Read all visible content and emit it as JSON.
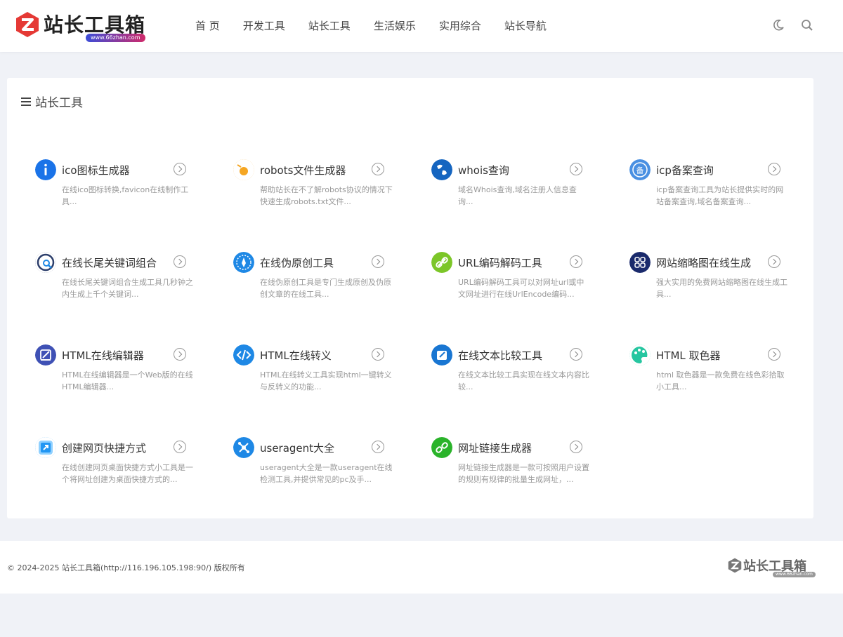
{
  "header": {
    "logo_text": "站长工具箱",
    "logo_url": "www.66zhan.com",
    "nav": [
      "首 页",
      "开发工具",
      "站长工具",
      "生活娱乐",
      "实用综合",
      "站长导航"
    ],
    "icons": [
      "moon-icon",
      "search-icon"
    ]
  },
  "section": {
    "title": "站长工具"
  },
  "tools": [
    {
      "name": "ico图标生成器",
      "desc": "在线ico图标转换,favicon在线制作工具...",
      "icon": "info-icon",
      "color": "#1a73e8"
    },
    {
      "name": "robots文件生成器",
      "desc": "帮助站长在不了解robots协议的情况下快速生成robots.txt文件...",
      "icon": "robot-icon",
      "color": "#f5a623"
    },
    {
      "name": "whois查询",
      "desc": "域名Whois查询,域名注册人信息查询...",
      "icon": "globe-icon",
      "color": "#1565c0"
    },
    {
      "name": "icp备案查询",
      "desc": "icp备案查询工具为站长提供实时的网站备案查询,域名备案查询...",
      "icon": "record-icon",
      "color": "#4a90e2"
    },
    {
      "name": "在线长尾关键词组合",
      "desc": "在线长尾关键词组合生成工具几秒钟之内生成上千个关键词...",
      "icon": "magnifier-icon",
      "color": "#2c3e6b"
    },
    {
      "name": "在线伪原创工具",
      "desc": "在线伪原创工具是专门生成原创及伪原创文章的在线工具...",
      "icon": "pen-icon",
      "color": "#1e88e5"
    },
    {
      "name": "URL编码解码工具",
      "desc": "URL编码解码工具可以对网址url或中文网址进行在线UrlEncode编码...",
      "icon": "link-icon",
      "color": "#7cc628"
    },
    {
      "name": "网站缩略图在线生成",
      "desc": "强大实用的免费网站缩略图在线生成工具...",
      "icon": "grid-icon",
      "color": "#1a2a6c"
    },
    {
      "name": "HTML在线编辑器",
      "desc": "HTML在线编辑器是一个Web版的在线HTML编辑器...",
      "icon": "edit-icon",
      "color": "#3f51b5"
    },
    {
      "name": "HTML在线转义",
      "desc": "HTML在线转义工具实现html一键转义与反转义的功能...",
      "icon": "code-icon",
      "color": "#1e88e5"
    },
    {
      "name": "在线文本比较工具",
      "desc": "在线文本比较工具实现在线文本内容比较...",
      "icon": "compare-icon",
      "color": "#1976d2"
    },
    {
      "name": "HTML 取色器",
      "desc": "html 取色器是一款免费在线色彩拾取小工具...",
      "icon": "palette-icon",
      "color": "#26c6a0"
    },
    {
      "name": "创建网页快捷方式",
      "desc": "在线创建网页桌面快捷方式小工具是一个将网址创建为桌面快捷方式的...",
      "icon": "shortcut-icon",
      "color": "#2196f3"
    },
    {
      "name": "useragent大全",
      "desc": "useragent大全是一款useragent在线检测工具,并提供常见的pc及手...",
      "icon": "network-icon",
      "color": "#1e88e5"
    },
    {
      "name": "网址链接生成器",
      "desc": "网址链接生成器是一款可按照用户设置的规则有规律的批量生成网址，...",
      "icon": "chain-icon",
      "color": "#2ab32a"
    }
  ],
  "footer": {
    "copyright": "© 2024-2025 站长工具箱(http://116.196.105.198:90/) 版权所有",
    "logo_text": "站长工具箱",
    "logo_url": "www.66zhan.com"
  }
}
